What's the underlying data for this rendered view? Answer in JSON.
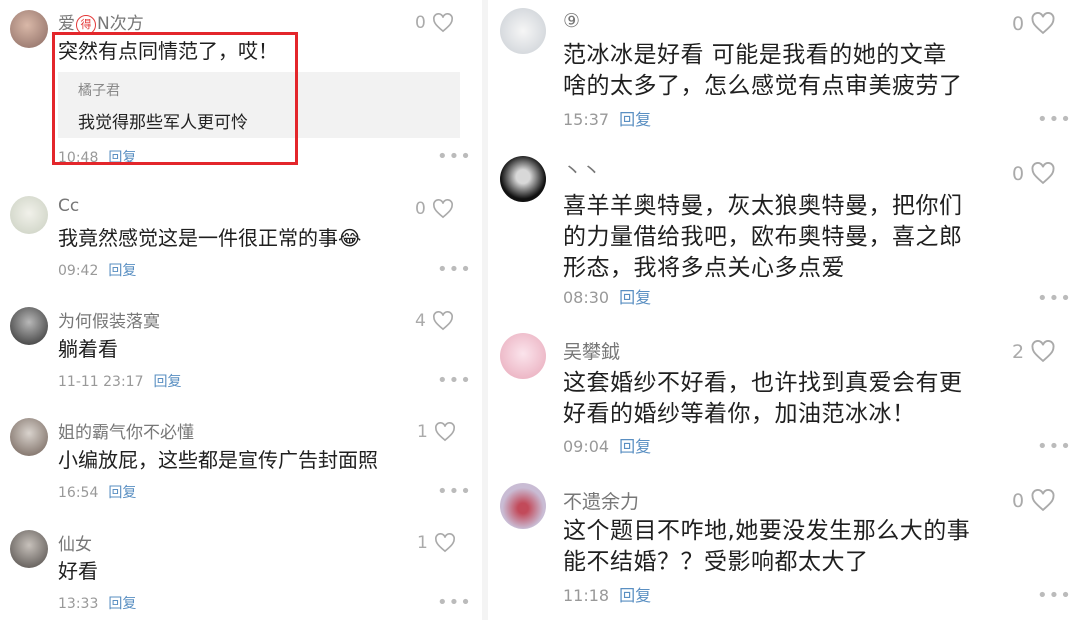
{
  "left": [
    {
      "name_prefix": "爱",
      "name_badge": "得",
      "name_suffix": "N次方",
      "text": "突然有点同情范了，哎！",
      "quote": {
        "name": "橘子君",
        "text": "我觉得那些军人更可怜"
      },
      "time": "10:48",
      "reply": "回复",
      "likes": "0"
    },
    {
      "name": "Cc",
      "text": "我竟然感觉这是一件很正常的事😂",
      "time": "09:42",
      "reply": "回复",
      "likes": "0"
    },
    {
      "name": "为何假装落寞",
      "text": "躺着看",
      "time": "11-11 23:17",
      "reply": "回复",
      "likes": "4"
    },
    {
      "name": "姐的霸气你不必懂",
      "text": "小编放屁，这些都是宣传广告封面照",
      "time": "16:54",
      "reply": "回复",
      "likes": "1"
    },
    {
      "name": "仙女",
      "text": "好看",
      "time": "13:33",
      "reply": "回复",
      "likes": "1"
    }
  ],
  "right": [
    {
      "name": "⑨",
      "text_lines": [
        "范冰冰是好看  可能是我看的她的文章",
        "啥的太多了，怎么感觉有点审美疲劳了"
      ],
      "time": "15:37",
      "reply": "回复",
      "likes": "0"
    },
    {
      "name": "丶丶",
      "text_lines": [
        "喜羊羊奥特曼，灰太狼奥特曼，把你们",
        "的力量借给我吧，欧布奥特曼，喜之郎",
        "形态，我将多点关心多点爱"
      ],
      "time": "08:30",
      "reply": "回复",
      "likes": "0"
    },
    {
      "name": "吴攀鉞",
      "text_lines": [
        "这套婚纱不好看，也许找到真爱会有更",
        "好看的婚纱等着你，加油范冰冰！"
      ],
      "time": "09:04",
      "reply": "回复",
      "likes": "2"
    },
    {
      "name": "不遗余力",
      "text_lines": [
        "这个题目不咋地,她要没发生那么大的事",
        "能不结婚？？受影响都太大了"
      ],
      "time": "11:18",
      "reply": "回复",
      "likes": "0"
    }
  ],
  "icons": {
    "like": "heart-outline-icon",
    "more": "more-dots-icon"
  },
  "colors": {
    "highlight": "#e3262b",
    "reply_link": "#5a8fc2",
    "quote_bg": "#f2f2f2"
  }
}
